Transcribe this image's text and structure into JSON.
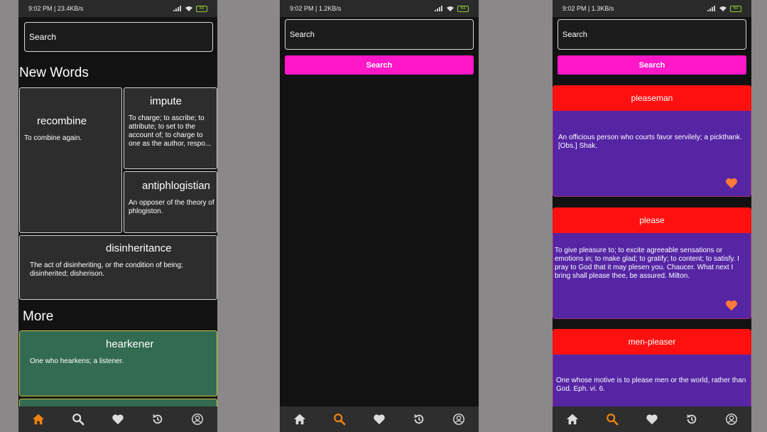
{
  "colors": {
    "accent_pink": "#ff17c8",
    "active_orange": "#f0820f",
    "result_header_red": "#ff1010",
    "result_body_purple": "#5525a4",
    "heart_orange": "#ff7a3a"
  },
  "screen1": {
    "status": {
      "time": "9:02 PM | 23.4KB/s",
      "battery": "63"
    },
    "search": {
      "placeholder": "Search"
    },
    "section_new": "New Words",
    "cards": [
      {
        "word": "recombine",
        "definition": "To combine again."
      },
      {
        "word": "impute",
        "definition": "To charge; to ascribe; to attribute; to set to the account of; to charge to one as the author, respo..."
      },
      {
        "word": "antiphlogistian",
        "definition": "An opposer of the theory of phlogiston."
      },
      {
        "word": "disinheritance",
        "definition": "The act of disinheriting, or the condition of being; disinherited; disherison."
      }
    ],
    "section_more": "More",
    "more_cards": [
      {
        "word": "hearkener",
        "definition": "One who hearkens; a listener."
      }
    ]
  },
  "screen2": {
    "status": {
      "time": "9:02 PM | 1.2KB/s",
      "battery": "63"
    },
    "search": {
      "placeholder": "Search"
    },
    "search_button": "Search"
  },
  "screen3": {
    "status": {
      "time": "9:02 PM | 1.3KB/s",
      "battery": "63"
    },
    "search": {
      "placeholder": "Search"
    },
    "search_button": "Search",
    "results": [
      {
        "word": "pleaseman",
        "definition": "An officious person who courts favor servilely; a pickthank. [Obs.] Shak."
      },
      {
        "word": "please",
        "definition": "To give pleasure to; to excite agreeable sensations or emotions in; to make glad; to gratify; to content; to satisfy. I pray to God that it may plesen you. Chaucer. What next I bring shall please thee, be assured. Milton."
      },
      {
        "word": "men-pleaser",
        "definition": "One whose motive is to please men or the world, rather than God. Eph. vi. 6."
      }
    ]
  },
  "nav": {
    "items": [
      {
        "icon": "home-icon"
      },
      {
        "icon": "search-icon"
      },
      {
        "icon": "heart-icon"
      },
      {
        "icon": "history-icon"
      },
      {
        "icon": "profile-icon"
      }
    ]
  }
}
